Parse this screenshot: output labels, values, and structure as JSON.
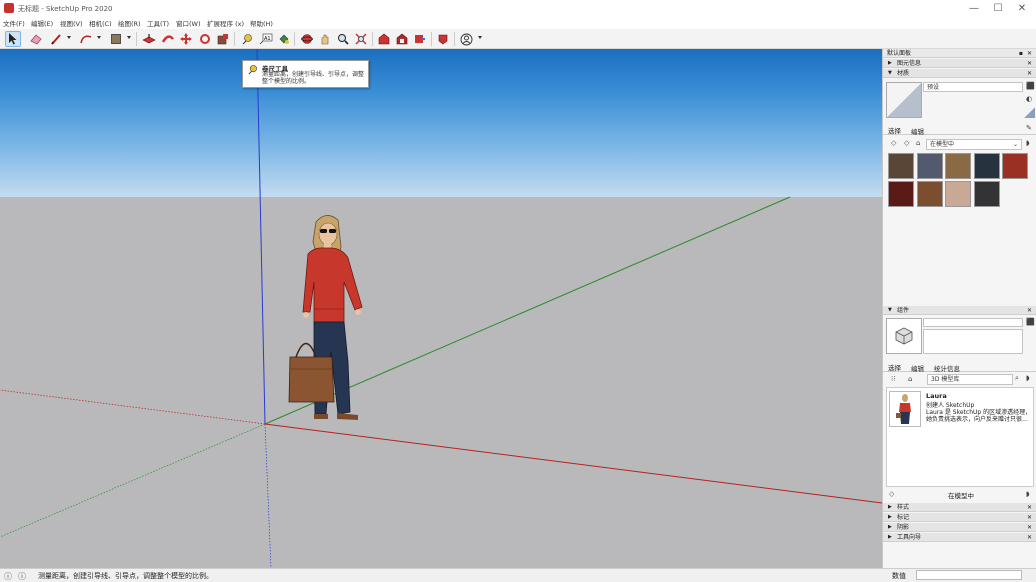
{
  "window": {
    "title": "无标题 - SketchUp Pro 2020",
    "min": "—",
    "max": "☐",
    "close": "✕"
  },
  "menu": [
    {
      "label": "文件(F)"
    },
    {
      "label": "编辑(E)"
    },
    {
      "label": "视图(V)"
    },
    {
      "label": "相机(C)"
    },
    {
      "label": "绘图(R)"
    },
    {
      "label": "工具(T)"
    },
    {
      "label": "窗口(W)"
    },
    {
      "label": "扩展程序 (x)"
    },
    {
      "label": "帮助(H)"
    }
  ],
  "toolbar": {
    "icons": [
      "select-arrow",
      "eraser",
      "pencil-line",
      "arc",
      "shape",
      "push-pull",
      "follow-me",
      "move",
      "rotate",
      "scale",
      "tape-measure",
      "text",
      "paint-bucket",
      "orbit",
      "pan",
      "zoom",
      "zoom-extents",
      "warehouse",
      "extension-warehouse",
      "layout",
      "send",
      "account"
    ]
  },
  "tooltip": {
    "title": "卷尺工具",
    "description": "测量距离，创建引导线、引导点，调整整个模型的比例。"
  },
  "status": {
    "text": "测量距离，创建引导线、引导点，调整整个模型的比例。",
    "measure_label": "数值",
    "measure_value": ""
  },
  "panel": {
    "tray_title": "默认面板",
    "entity_info": "图元信息",
    "materials": {
      "header": "材质",
      "name_placeholder": "预设",
      "tab_select": "选择",
      "tab_edit": "编辑",
      "collection": "在模型中",
      "swatches": [
        "#5a4636",
        "#545a6e",
        "#8a6a44",
        "#27323f",
        "#9a2f23",
        "#5a1a15",
        "#7a4e2f",
        "#c9a995",
        "#333336"
      ]
    },
    "components": {
      "header": "组件",
      "tab_select": "选择",
      "tab_edit": "编辑",
      "tab_stats": "统计信息",
      "search_placeholder": "3D 模型库",
      "item_name": "Laura",
      "item_line1": "创建人 SketchUp",
      "item_line2": "Laura 是 SketchUp 的区域渗透经理，",
      "item_line3": "她负责挑选表示，向户反来赠讨只很…",
      "collection": "在模型中"
    },
    "styles": "样式",
    "tags": "标记",
    "shadows": "阴影",
    "instructor": "工具向导"
  }
}
